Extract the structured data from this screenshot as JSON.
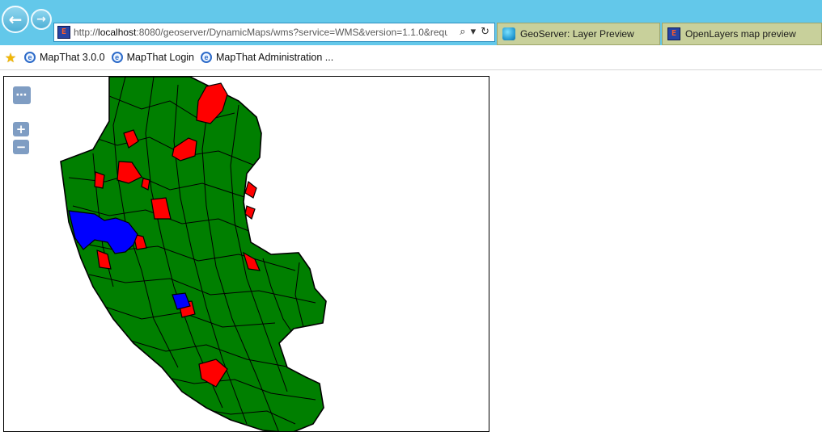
{
  "browser": {
    "address": {
      "url_prefix": "http://",
      "url_host": "localhost",
      "url_rest": ":8080/geoserver/DynamicMaps/wms?service=WMS&version=1.1.0&requ"
    },
    "tabs": [
      {
        "label": "GeoServer: Layer Preview",
        "icon": "geoserver-icon"
      },
      {
        "label": "OpenLayers map preview",
        "icon": "openlayers-icon"
      }
    ],
    "favorites": [
      {
        "label": "MapThat 3.0.0",
        "icon": "ie-icon"
      },
      {
        "label": "MapThat Login",
        "icon": "ie-icon"
      },
      {
        "label": "MapThat Administration ...",
        "icon": "ie-icon"
      }
    ]
  },
  "map": {
    "controls": {
      "layer_switcher": "⋯",
      "zoom_in": "+",
      "zoom_out": "−"
    },
    "colors": {
      "green": "#007f00",
      "red": "#ff0000",
      "blue": "#0000ff"
    }
  }
}
